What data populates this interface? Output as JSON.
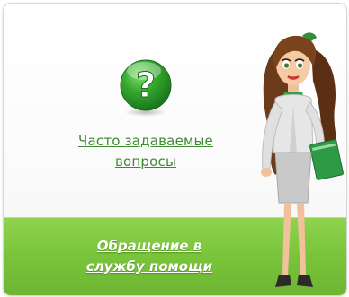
{
  "faq": {
    "icon": "question-mark-icon",
    "link_line1": "Часто задаваемые",
    "link_line2": "вопросы"
  },
  "support": {
    "link_line1": "Обращение в",
    "link_line2": "службу помощи"
  },
  "assistant": {
    "image": "assistant-girl-illustration"
  },
  "colors": {
    "link_green": "#3d8a2f",
    "bar_green": "#7bc53c",
    "icon_green": "#2f9b2a",
    "scarf_green": "#2fa34a"
  }
}
